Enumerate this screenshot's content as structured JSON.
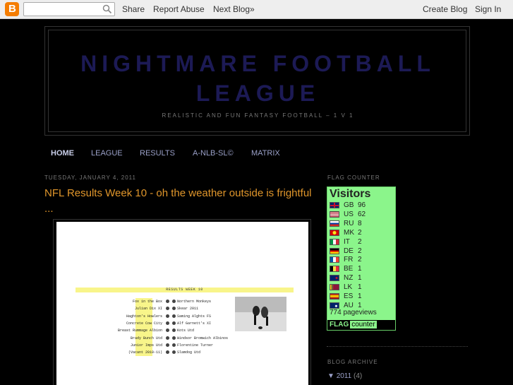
{
  "navbar": {
    "logo_letter": "B",
    "search_placeholder": "",
    "share": "Share",
    "report_abuse": "Report Abuse",
    "next_blog": "Next Blog»",
    "create_blog": "Create Blog",
    "sign_in": "Sign In"
  },
  "header": {
    "title": "NIGHTMARE FOOTBALL LEAGUE",
    "description": "REALISTIC AND FUN FANTASY FOOTBALL – 1 V 1",
    "title_color": "#1c1a55"
  },
  "tabs": [
    {
      "label": "HOME",
      "active": true
    },
    {
      "label": "LEAGUE",
      "active": false
    },
    {
      "label": "RESULTS",
      "active": false
    },
    {
      "label": "A-NLB-SL©",
      "active": false
    },
    {
      "label": "MATRIX",
      "active": false
    }
  ],
  "post": {
    "date": "TUESDAY, JANUARY 4, 2011",
    "title": "NFL Results Week 10 - oh the weather outside is frightful ...",
    "title_color": "#e0962b",
    "image": {
      "header": "RESULTS WEEK 10",
      "fixtures": [
        {
          "home": "Fox in the Box",
          "away": "Northern Monkeys"
        },
        {
          "home": "Julian Dix XI",
          "away": "Skear 2011"
        },
        {
          "home": "Haghton's Howlers",
          "away": "Saming Alghts FS"
        },
        {
          "home": "Concrete Cow City",
          "away": "Alf Garnett's XI"
        },
        {
          "home": "Breast Rummage Albion",
          "away": "Kots Utd"
        },
        {
          "home": "Brady Bunch Utd",
          "away": "Windsor Bromwich Albinos"
        },
        {
          "home": "Junior Imps Utd",
          "away": "Florentine Turner"
        },
        {
          "home": "(Vacant 2010-11)",
          "away": "Slamdog Utd"
        }
      ]
    }
  },
  "sidebar": {
    "flag_counter_heading": "FLAG COUNTER",
    "flag_counter": {
      "title": "Visitors",
      "rows": [
        {
          "code": "GB",
          "count": "96",
          "flag": "gb"
        },
        {
          "code": "US",
          "count": "62",
          "flag": "us"
        },
        {
          "code": "RU",
          "count": "8",
          "flag": "ru"
        },
        {
          "code": "MK",
          "count": "2",
          "flag": "mk"
        },
        {
          "code": "IT",
          "count": "2",
          "flag": "it"
        },
        {
          "code": "DE",
          "count": "2",
          "flag": "de"
        },
        {
          "code": "FR",
          "count": "2",
          "flag": "fr"
        },
        {
          "code": "BE",
          "count": "1",
          "flag": "be"
        },
        {
          "code": "NZ",
          "count": "1",
          "flag": "nz"
        },
        {
          "code": "LK",
          "count": "1",
          "flag": "lk"
        },
        {
          "code": "ES",
          "count": "1",
          "flag": "es"
        },
        {
          "code": "AU",
          "count": "1",
          "flag": "au"
        }
      ],
      "pageviews": "774 pageviews",
      "logo_flag": "FLAG",
      "logo_counter": "counter"
    },
    "blog_archive_heading": "BLOG ARCHIVE",
    "archive": {
      "toggle": "▼",
      "year": "2011",
      "count": "(4)"
    }
  }
}
